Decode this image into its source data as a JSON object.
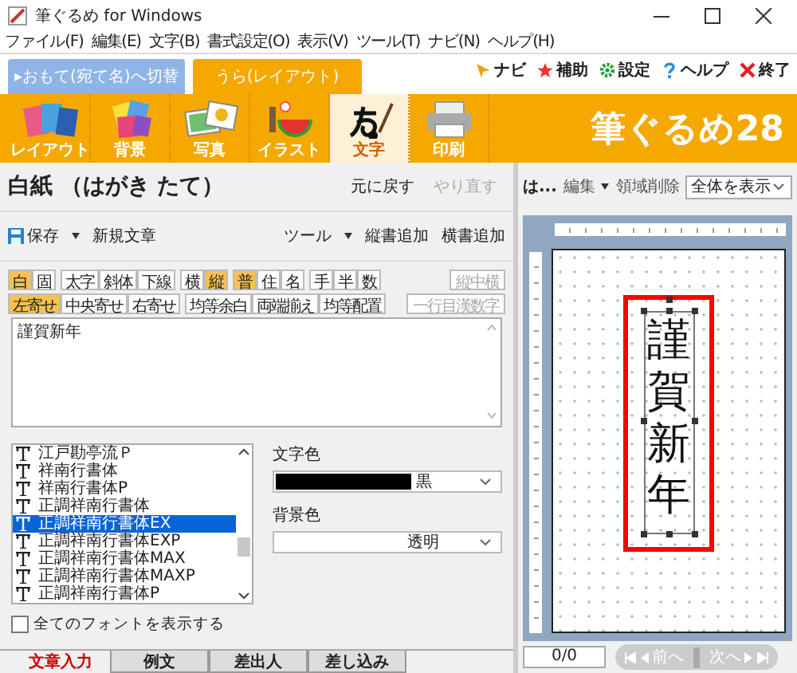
{
  "window": {
    "title": "筆ぐるめ for Windows"
  },
  "menu": [
    "ファイル(F)",
    "編集(E)",
    "文字(B)",
    "書式設定(O)",
    "表示(V)",
    "ツール(T)",
    "ナビ(N)",
    "ヘルプ(H)"
  ],
  "side_tabs": [
    {
      "label": "▸おもて(宛て名)へ切替",
      "selected": false
    },
    {
      "label": "うら(レイアウト)",
      "selected": true
    }
  ],
  "quick_links": [
    {
      "kind": "navi",
      "label": "ナビ"
    },
    {
      "kind": "assist",
      "label": "補助"
    },
    {
      "kind": "settings",
      "label": "設定"
    },
    {
      "kind": "help",
      "label": "ヘルプ"
    },
    {
      "kind": "exit",
      "label": "終了"
    }
  ],
  "modes": [
    {
      "kind": "layout",
      "label": "レイアウト",
      "selected": false
    },
    {
      "kind": "background",
      "label": "背景",
      "selected": false
    },
    {
      "kind": "photo",
      "label": "写真",
      "selected": false
    },
    {
      "kind": "illust",
      "label": "イラスト",
      "selected": false
    },
    {
      "kind": "text",
      "label": "文字",
      "selected": true
    },
    {
      "kind": "print",
      "label": "印刷",
      "selected": false
    }
  ],
  "logo": "筆ぐるめ28",
  "document": {
    "title": "白紙 （はがき たて）",
    "undo": {
      "label": "元に戻す",
      "disabled": false
    },
    "redo": {
      "label": "やり直す",
      "disabled": true
    }
  },
  "doc_toolbar": {
    "save": "保存",
    "new": "新規文章",
    "tools": "ツール",
    "add_vertical": "縦書追加",
    "add_horizontal": "横書追加"
  },
  "format_rows": [
    [
      [
        {
          "label": "白",
          "selected": true,
          "disabled": false
        },
        {
          "label": "固",
          "selected": false,
          "disabled": false
        }
      ],
      [
        {
          "label": "太字",
          "selected": false,
          "disabled": false
        },
        {
          "label": "斜体",
          "selected": false,
          "disabled": false
        },
        {
          "label": "下線",
          "selected": false,
          "disabled": false
        }
      ],
      [
        {
          "label": "横",
          "selected": false,
          "disabled": false
        },
        {
          "label": "縦",
          "selected": true,
          "disabled": false
        }
      ],
      [
        {
          "label": "普",
          "selected": true,
          "disabled": false
        },
        {
          "label": "住",
          "selected": false,
          "disabled": false
        },
        {
          "label": "名",
          "selected": false,
          "disabled": false
        }
      ],
      [
        {
          "label": "手",
          "selected": false,
          "disabled": false
        },
        {
          "label": "半",
          "selected": false,
          "disabled": false
        },
        {
          "label": "数",
          "selected": false,
          "disabled": false
        }
      ],
      [
        {
          "label": "縦中横",
          "selected": false,
          "disabled": true
        }
      ]
    ],
    [
      [
        {
          "label": "左寄せ",
          "selected": true,
          "disabled": false
        },
        {
          "label": "中央寄せ",
          "selected": false,
          "disabled": false
        },
        {
          "label": "右寄せ",
          "selected": false,
          "disabled": false
        }
      ],
      [
        {
          "label": "均等余白",
          "selected": false,
          "disabled": false
        },
        {
          "label": "両端揃え",
          "selected": false,
          "disabled": false
        },
        {
          "label": "均等配置",
          "selected": false,
          "disabled": false
        }
      ],
      [
        {
          "label": "一行目漢数字",
          "selected": false,
          "disabled": true
        }
      ]
    ]
  ],
  "text_input": {
    "value": "謹賀新年"
  },
  "fonts": [
    {
      "label": "江戸勘亭流Ｐ",
      "selected": false
    },
    {
      "label": "祥南行書体",
      "selected": false
    },
    {
      "label": "祥南行書体P",
      "selected": false
    },
    {
      "label": "正調祥南行書体",
      "selected": false
    },
    {
      "label": "正調祥南行書体EX",
      "selected": true
    },
    {
      "label": "正調祥南行書体EXP",
      "selected": false
    },
    {
      "label": "正調祥南行書体MAX",
      "selected": false
    },
    {
      "label": "正調祥南行書体MAXP",
      "selected": false
    },
    {
      "label": "正調祥南行書体P",
      "selected": false
    }
  ],
  "text_color": {
    "label": "文字色",
    "value": "黒",
    "color": "#000000"
  },
  "background_color": {
    "label": "背景色",
    "value": "透明"
  },
  "show_all_fonts": {
    "label": "全てのフォントを表示する",
    "checked": false
  },
  "bottom_tabs": [
    {
      "label": "文章入力",
      "selected": true
    },
    {
      "label": "例文",
      "selected": false
    },
    {
      "label": "差出人",
      "selected": false
    },
    {
      "label": "差し込み",
      "selected": false
    }
  ],
  "preview_toolbar": {
    "title": "は...",
    "edit": "編集",
    "delete_area": "領域削除",
    "zoom": "全体を表示"
  },
  "preview": {
    "text": "謹賀新年"
  },
  "pager": {
    "count": "0/0",
    "prev": "前へ",
    "next": "次へ",
    "disabled": true
  }
}
